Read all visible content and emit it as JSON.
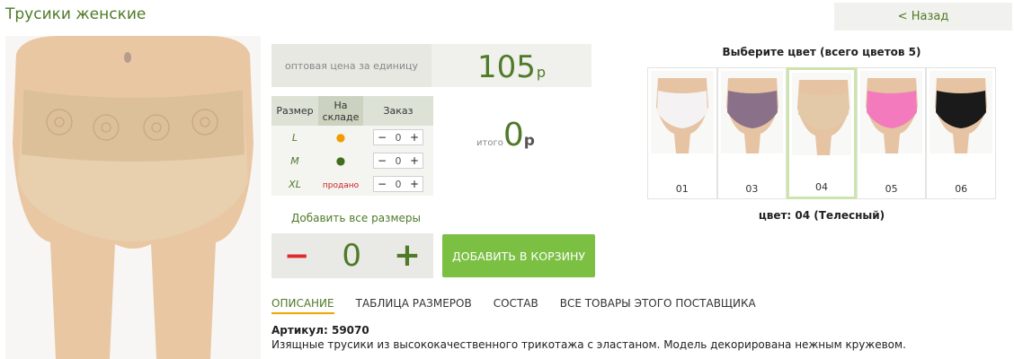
{
  "page": {
    "title": "Трусики женские",
    "back_label": "< Назад"
  },
  "price": {
    "label": "оптовая цена за единицу",
    "value": "105",
    "currency": "р"
  },
  "sizes_table": {
    "headers": {
      "size": "Размер",
      "stock_line1": "На",
      "stock_line2": "складе",
      "order": "Заказ"
    },
    "rows": [
      {
        "size": "L",
        "stock": "●",
        "stock_status": "low",
        "qty": "0",
        "minus": "−",
        "plus": "+"
      },
      {
        "size": "M",
        "stock": "●",
        "stock_status": "available",
        "qty": "0",
        "minus": "−",
        "plus": "+"
      },
      {
        "size": "XL",
        "stock": "продано",
        "stock_status": "sold",
        "qty": "0",
        "minus": "−",
        "plus": "+"
      }
    ]
  },
  "total": {
    "label": "итого",
    "value": "0",
    "currency": "р"
  },
  "add_all_sizes": "Добавить все размеры",
  "quantity": {
    "minus": "−",
    "value": "0",
    "plus": "+"
  },
  "add_to_cart": "ДОБАВИТЬ В КОРЗИНУ",
  "tabs": [
    {
      "label": "ОПИСАНИЕ",
      "active": true
    },
    {
      "label": "ТАБЛИЦА РАЗМЕРОВ",
      "active": false
    },
    {
      "label": "СОСТАВ",
      "active": false
    },
    {
      "label": "ВСЕ ТОВАРЫ ЭТОГО ПОСТАВЩИКА",
      "active": false
    }
  ],
  "article": "Артикул: 59070",
  "description": "Изящные трусики из высококачественного трикотажа с эластаном. Модель декорирована нежным кружевом.",
  "colors": {
    "title": "Выберите цвет (всего цветов 5)",
    "selected_label": "цвет: 04 (Телесный)",
    "swatches": [
      {
        "code": "01",
        "color": "#f4f2f3",
        "selected": false
      },
      {
        "code": "03",
        "color": "#8a7088",
        "selected": false
      },
      {
        "code": "04",
        "color": "#e3c9a8",
        "selected": true
      },
      {
        "code": "05",
        "color": "#f37bbd",
        "selected": false
      },
      {
        "code": "06",
        "color": "#1a1a1a",
        "selected": false
      }
    ]
  },
  "theme": {
    "accent_green": "#4f7a28",
    "button_green": "#7bc043",
    "minus_red": "#dd2b2b",
    "tab_underline": "#f2a300",
    "low_stock": "#f29b00",
    "in_stock": "#3f6f1d",
    "sold_text": "#cc2222",
    "product_color": "#e8cfae"
  }
}
